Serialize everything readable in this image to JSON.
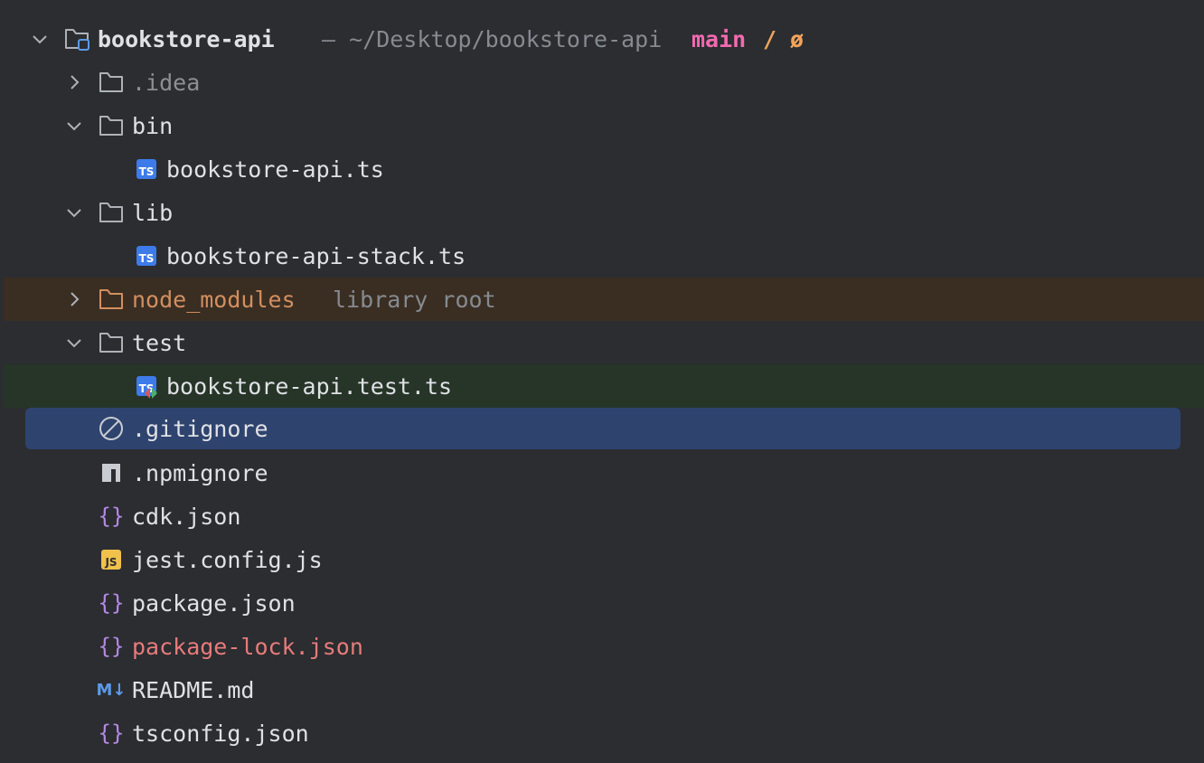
{
  "project": {
    "name": "bookstore-api",
    "path": "– ~/Desktop/bookstore-api",
    "branch": "main",
    "separator": "/",
    "status": "ø"
  },
  "tree": {
    "idea": ".idea",
    "bin": "bin",
    "bin_file": "bookstore-api.ts",
    "lib": "lib",
    "lib_file": "bookstore-api-stack.ts",
    "node_modules": "node_modules",
    "node_modules_hint": "library root",
    "test": "test",
    "test_file": "bookstore-api.test.ts",
    "gitignore": ".gitignore",
    "npmignore": ".npmignore",
    "cdk_json": "cdk.json",
    "jest_config": "jest.config.js",
    "package_json": "package.json",
    "package_lock": "package-lock.json",
    "readme": "README.md",
    "tsconfig": "tsconfig.json"
  },
  "icons": {
    "ts_badge": "TS",
    "js_badge": "JS",
    "json_glyph": "{}",
    "md_glyph": "M↓"
  },
  "colors": {
    "background": "#2b2d30",
    "selection": "#2e436e",
    "excluded_row": "#3a2e22",
    "test_row": "#263528",
    "branch": "#f26ab0",
    "ts_blue": "#3d7bea",
    "js_yellow": "#f0c14b",
    "json_purple": "#b389e6",
    "modified_red": "#e77b7b",
    "library_orange": "#d38e5f"
  }
}
